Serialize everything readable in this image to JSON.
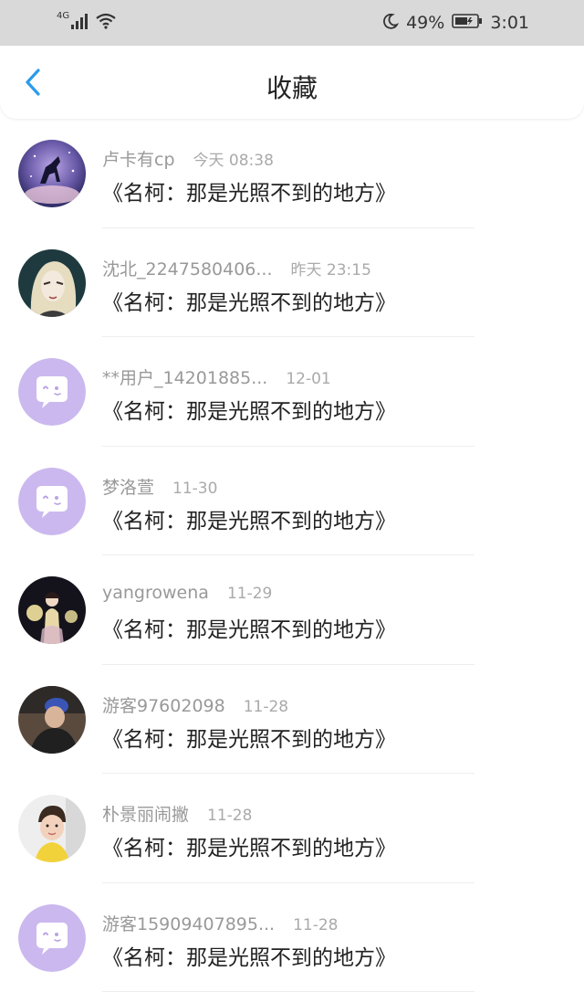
{
  "status_bar": {
    "network": "4G",
    "battery": "49%",
    "time": "3:01"
  },
  "header": {
    "title": "收藏",
    "accent_color": "#2b9bea"
  },
  "items": [
    {
      "username": "卢卡有cp",
      "time": "今天 08:38",
      "text": "《名柯：那是光照不到的地方》",
      "avatar": "unicorn"
    },
    {
      "username": "沈北_2247580406...",
      "time": "昨天 23:15",
      "text": "《名柯：那是光照不到的地方》",
      "avatar": "anime"
    },
    {
      "username": "**用户_14201885...",
      "time": "12-01",
      "text": "《名柯：那是光照不到的地方》",
      "avatar": "default"
    },
    {
      "username": "梦洛萱",
      "time": "11-30",
      "text": "《名柯：那是光照不到的地方》",
      "avatar": "default"
    },
    {
      "username": "yangrowena",
      "time": "11-29",
      "text": "《名柯：那是光照不到的地方》",
      "avatar": "costume"
    },
    {
      "username": "游客97602098",
      "time": "11-28",
      "text": "《名柯：那是光照不到的地方》",
      "avatar": "photo"
    },
    {
      "username": "朴景丽闹撇",
      "time": "11-28",
      "text": "《名柯：那是光照不到的地方》",
      "avatar": "child"
    },
    {
      "username": "游客15909407895...",
      "time": "11-28",
      "text": "《名柯：那是光照不到的地方》",
      "avatar": "default"
    }
  ]
}
